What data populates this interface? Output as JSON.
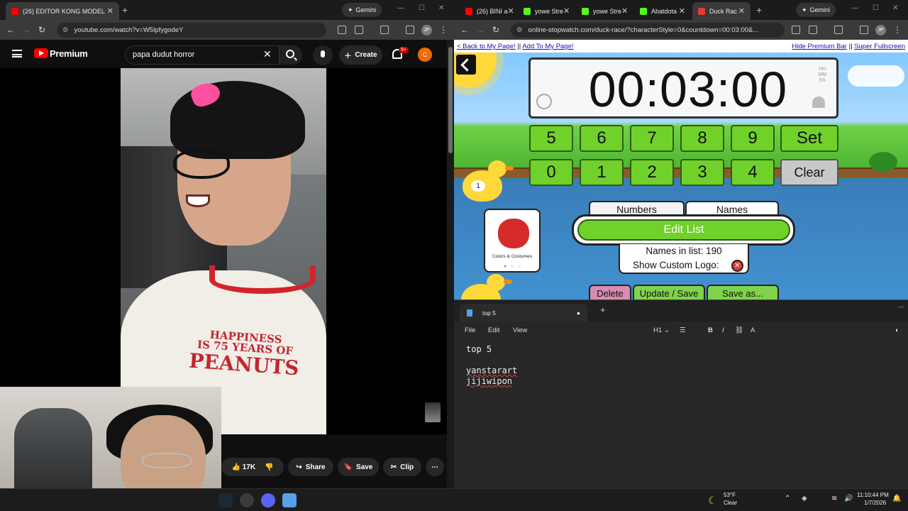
{
  "left_browser": {
    "tabs": [
      {
        "label": "(26) EDITOR KONG MODEL",
        "active": true
      }
    ],
    "gemini_label": "Gemini",
    "url": "youtube.com/watch?v=W5lpfygodeY",
    "profile_initials": "JP"
  },
  "youtube": {
    "brand": "Premium",
    "search_value": "papa dudut horror",
    "create_label": "Create",
    "notification_count": "9+",
    "user_initial": "C",
    "shirt_lines": [
      "HAPPINESS",
      "IS 75 YEARS OF",
      "PEANUTS"
    ],
    "actions": {
      "likes": "17K",
      "share": "Share",
      "save": "Save",
      "clip": "Clip"
    }
  },
  "right_browser": {
    "tabs": [
      {
        "label": "(26) BINI a"
      },
      {
        "label": "yowe Stre"
      },
      {
        "label": "yowe Stre"
      },
      {
        "label": "Abatdota"
      },
      {
        "label": "Duck Rac",
        "active": true
      }
    ],
    "gemini_label": "Gemini",
    "url": "online-stopwatch.com/duck-race/?characterStyle=0&countdown=00:03:00&...",
    "profile_initials": "JP"
  },
  "duck_race": {
    "links": {
      "back": "< Back to My Page!",
      "add": "Add To My Page!",
      "hide": "Hide Premium Bar",
      "fullscreen": "Super Fullscreen",
      "sep": "||"
    },
    "timer": "00:03:00",
    "timer_units": [
      "HH",
      "MM",
      "SS"
    ],
    "keys_row1": [
      "5",
      "6",
      "7",
      "8",
      "9",
      "Set"
    ],
    "keys_row2": [
      "0",
      "1",
      "2",
      "3",
      "4",
      "Clear"
    ],
    "duck_number": "1",
    "costume_label": "Colors & Costumes",
    "tab_numbers": "Numbers",
    "tab_names": "Names",
    "edit_list": "Edit List",
    "names_in_list": "Names in list: 190",
    "show_custom_logo": "Show Custom Logo:",
    "buttons": [
      "Delete",
      "Update / Save",
      "Save as..."
    ]
  },
  "notepad": {
    "tab_title": "top 5",
    "menu": [
      "File",
      "Edit",
      "View"
    ],
    "heading_select": "H1",
    "lines": [
      "top 5",
      "",
      "yanstarart",
      "jijiwipon"
    ]
  },
  "taskbar": {
    "weather_temp": "53°F",
    "weather_desc": "Clear",
    "time": "11:10:44 PM",
    "date": "1/7/2026"
  },
  "colors": {
    "youtube_red": "#ff0000",
    "keypad_green": "#6fd12a",
    "duck_yellow": "#ffd83a"
  }
}
